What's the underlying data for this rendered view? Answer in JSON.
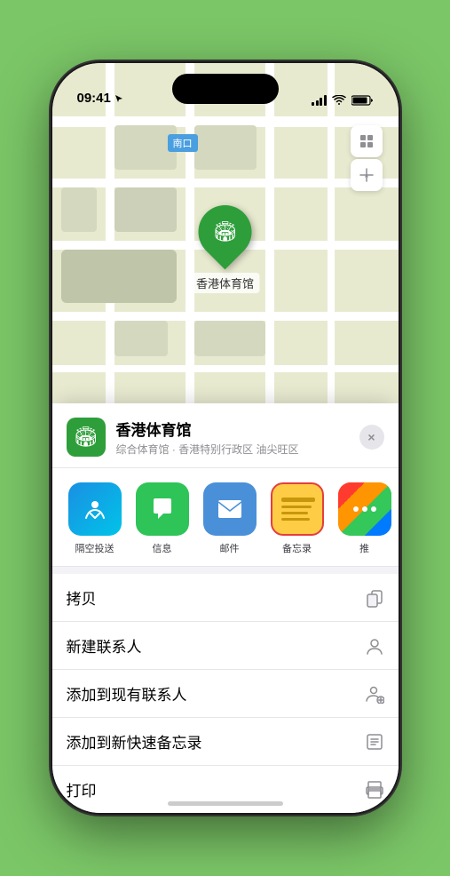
{
  "phone": {
    "status_bar": {
      "time": "09:41",
      "location_arrow": "▶"
    },
    "map": {
      "label": "南口",
      "pin_label": "香港体育馆"
    },
    "venue_card": {
      "name": "香港体育馆",
      "subtitle": "综合体育馆 · 香港特别行政区 油尖旺区",
      "close_label": "×"
    },
    "share_items": [
      {
        "id": "airdrop",
        "label": "隔空投送",
        "icon": "📡"
      },
      {
        "id": "messages",
        "label": "信息",
        "icon": "💬"
      },
      {
        "id": "mail",
        "label": "邮件",
        "icon": "✉️"
      },
      {
        "id": "notes",
        "label": "备忘录",
        "icon": ""
      },
      {
        "id": "more",
        "label": "推",
        "icon": "⋯"
      }
    ],
    "actions": [
      {
        "id": "copy",
        "label": "拷贝",
        "icon": "⎘"
      },
      {
        "id": "new-contact",
        "label": "新建联系人",
        "icon": "👤"
      },
      {
        "id": "add-existing",
        "label": "添加到现有联系人",
        "icon": "👤"
      },
      {
        "id": "add-notes",
        "label": "添加到新快速备忘录",
        "icon": "🖊"
      },
      {
        "id": "print",
        "label": "打印",
        "icon": "🖨"
      }
    ]
  }
}
